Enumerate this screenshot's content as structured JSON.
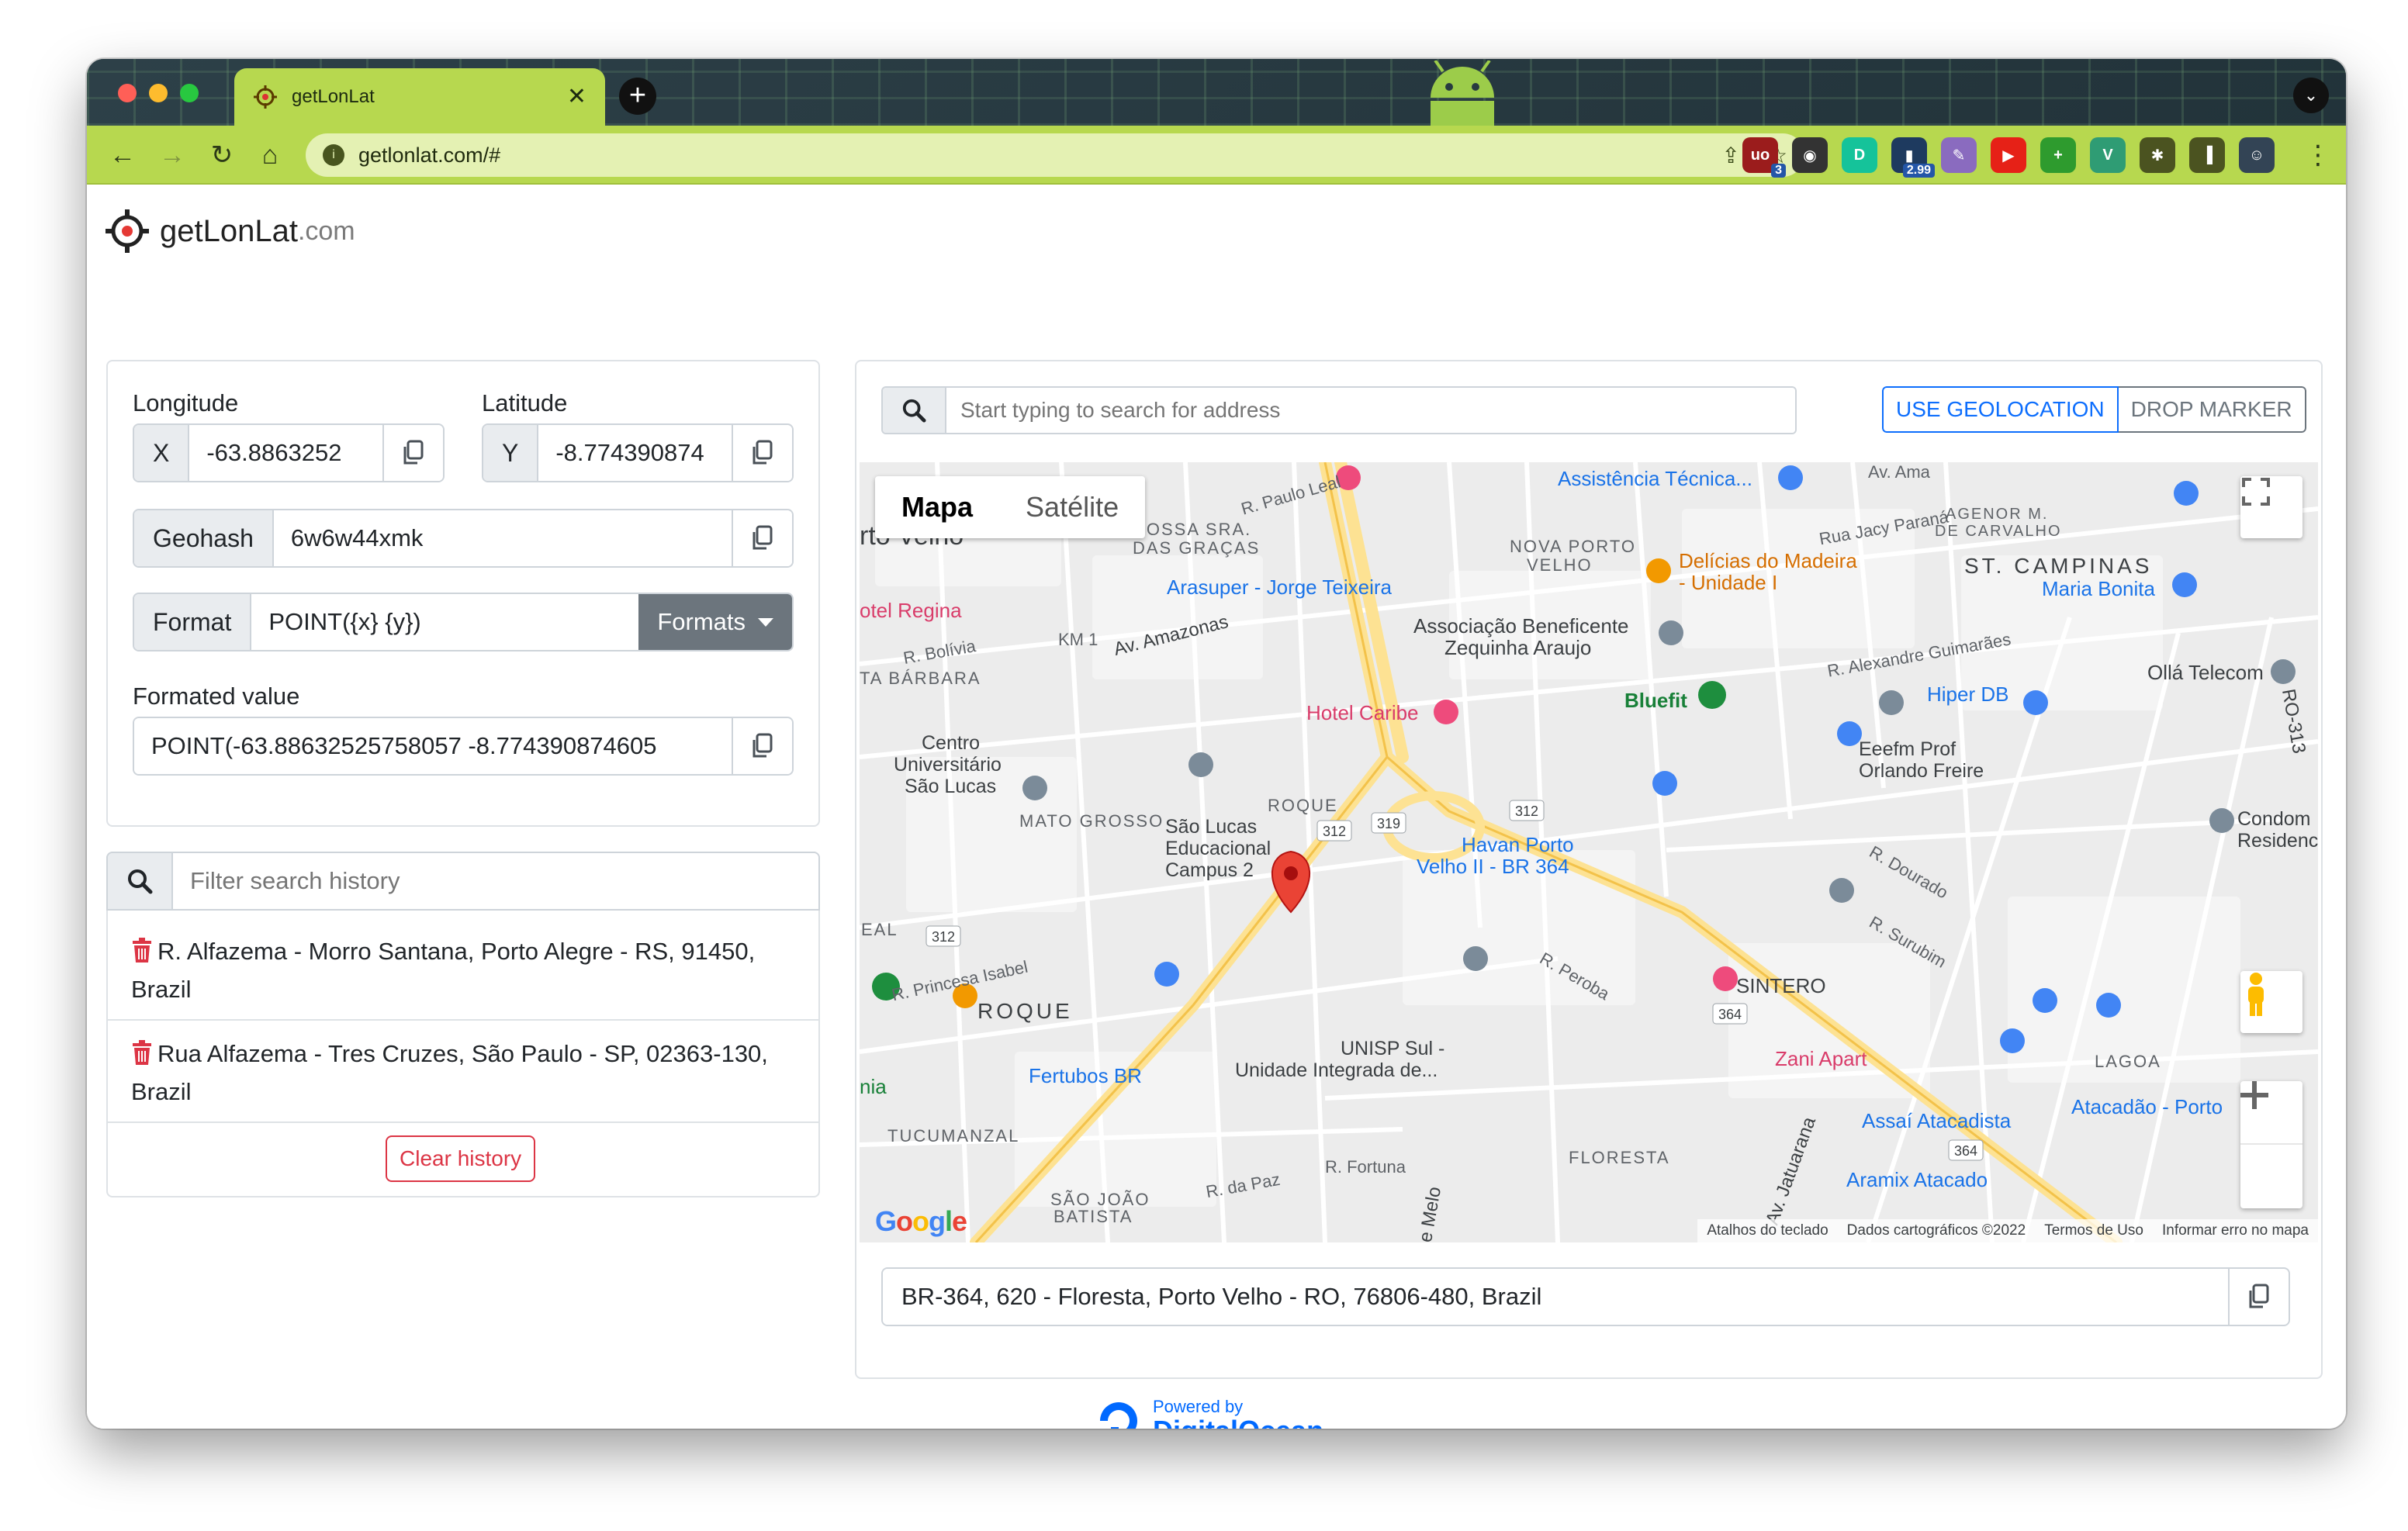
{
  "browser": {
    "tab_title": "getLonLat",
    "url": "getlonlat.com/#",
    "extensions": [
      {
        "name": "ublock-icon",
        "label": "uo",
        "badge": "3",
        "color": "#9b1c1c"
      },
      {
        "name": "incognito-ext-icon",
        "label": "◉",
        "badge": "",
        "color": "#333333"
      },
      {
        "name": "grammar-ext-icon",
        "label": "D",
        "badge": "",
        "color": "#15c39a"
      },
      {
        "name": "price-ext-icon",
        "label": "▮",
        "badge": "2.99",
        "color": "#1e3a5f"
      },
      {
        "name": "pen-ext-icon",
        "label": "✎",
        "badge": "",
        "color": "#8a6bbf"
      },
      {
        "name": "youtube-ext-icon",
        "label": "▶",
        "badge": "",
        "color": "#e62117"
      },
      {
        "name": "plus-ext-icon",
        "label": "+",
        "badge": "",
        "color": "#2e9b2e"
      },
      {
        "name": "vue-ext-icon",
        "label": "V",
        "badge": "",
        "color": "#2f9c74"
      },
      {
        "name": "puzzle-ext-icon",
        "label": "✱",
        "badge": "",
        "color": "#4b5320"
      },
      {
        "name": "sidebar-ext-icon",
        "label": "▐",
        "badge": "",
        "color": "#4b5320"
      },
      {
        "name": "profile-avatar-icon",
        "label": "☺",
        "badge": "",
        "color": "#334455"
      }
    ]
  },
  "brand": {
    "main": "getLonLat",
    "suffix": ".com"
  },
  "coords": {
    "longitude_label": "Longitude",
    "latitude_label": "Latitude",
    "x_addon": "X",
    "y_addon": "Y",
    "x_value": "-63.8863252",
    "y_value": "-8.774390874",
    "geohash_label": "Geohash",
    "geohash_value": "6w6w44xmk",
    "format_label": "Format",
    "format_value": "POINT({x} {y})",
    "formats_button": "Formats",
    "formatted_label": "Formated value",
    "formatted_value": "POINT(-63.88632525758057 -8.774390874605"
  },
  "history": {
    "filter_placeholder": "Filter search history",
    "items": [
      "R. Alfazema - Morro Santana, Porto Alegre - RS, 91450, Brazil",
      "Rua Alfazema - Tres Cruzes, São Paulo - SP, 02363-130, Brazil"
    ],
    "clear_button": "Clear history"
  },
  "search": {
    "placeholder": "Start typing to search for address",
    "geolocation_button": "USE GEOLOCATION",
    "drop_marker_button": "DROP MARKER"
  },
  "map": {
    "tab_map": "Mapa",
    "tab_satellite": "Satélite",
    "attribution": [
      "Atalhos do teclado",
      "Dados cartográficos ©2022",
      "Termos de Uso",
      "Informar erro no mapa"
    ],
    "google_logo": "Google",
    "labels": {
      "assistencia": "Assistência Técnica...",
      "av_amazonas_top": "Av. Ama",
      "r_paulo_leal": "R. Paulo Leal",
      "vila_velho": "rto Velho",
      "nossa_sra": "NOSSA SRA.",
      "das_gracas": "DAS GRAÇAS",
      "nova_porto": "NOVA PORTO",
      "velho": "VELHO",
      "delicias1": "Delícias do Madeira",
      "delicias2": "- Unidade I",
      "jacy": "Rua Jacy Paraná",
      "agenor1": "AGENOR M.",
      "agenor2": "DE CARVALHO",
      "st_campinas": "ST. CAMPINAS",
      "maria_bonita": "Maria Bonita",
      "hotel_regina": "otel Regina",
      "arasuper": "Arasuper - Jorge Teixeira",
      "km1": "KM 1",
      "av_amazonas": "Av. Amazonas",
      "r_bolivia": "R. Bolívia",
      "sta_barbara": "TA BÁRBARA",
      "assoc1": "Associação Beneficente",
      "assoc2": "Zequinha Araujo",
      "r_alexandre": "R. Alexandre Guimarães",
      "olla": "Ollá Telecom",
      "hiper_db": "Hiper DB",
      "bluefit": "Bluefit",
      "hotel_caribe": "Hotel Caribe",
      "centro1": "Centro",
      "centro2": "Universitário",
      "centro3": "São Lucas",
      "eeefm1": "Eeefm Prof",
      "eeefm2": "Orlando Freire",
      "mato_grosso": "MATO GROSSO",
      "sao_lucas1": "São Lucas",
      "sao_lucas2": "Educacional",
      "sao_lucas3": "Campus 2",
      "roque_top": "ROQUE",
      "havan1": "Havan Porto",
      "havan2": "Velho II - BR 364",
      "condom1": "Condom",
      "condom2": "Residenc",
      "eal": "EAL",
      "r_princesa": "R. Princesa Isabel",
      "roque_big": "ROQUE",
      "sintero": "SINTERO",
      "zani": "Zani Apart",
      "lagoa": "LAGOA",
      "fertubos": "Fertubos BR",
      "unisp1": "UNISP Sul -",
      "unisp2": "Unidade Integrada de...",
      "nia": "nia",
      "tucumanzal": "TUCUMANZAL",
      "assai": "Assaí Atacadista",
      "atacadao": "Atacadão - Porto",
      "floresta": "FLORESTA",
      "aramix": "Aramix Atacado",
      "sao_joao1": "SÃO JOÃO",
      "sao_joao2": "BATISTA",
      "r_da_paz": "R. da Paz",
      "r_fortuna": "R. Fortuna",
      "av_jatuarana": "Av. Jatuarana",
      "se_melo": "e Melo",
      "r_peroba": "R. Peroba",
      "r_surubim": "R. Surubim",
      "r_dourado": "R. Dourado",
      "ro_313": "RO-313",
      "badge_312a": "312",
      "badge_312b": "312",
      "badge_312c": "312",
      "badge_319": "319",
      "badge_364a": "364",
      "badge_364b": "364"
    }
  },
  "address": {
    "value": "BR-364, 620 - Floresta, Porto Velho - RO, 76806-480, Brazil"
  },
  "footer": {
    "powered_by": "Powered by",
    "brand": "DigitalOcean"
  }
}
